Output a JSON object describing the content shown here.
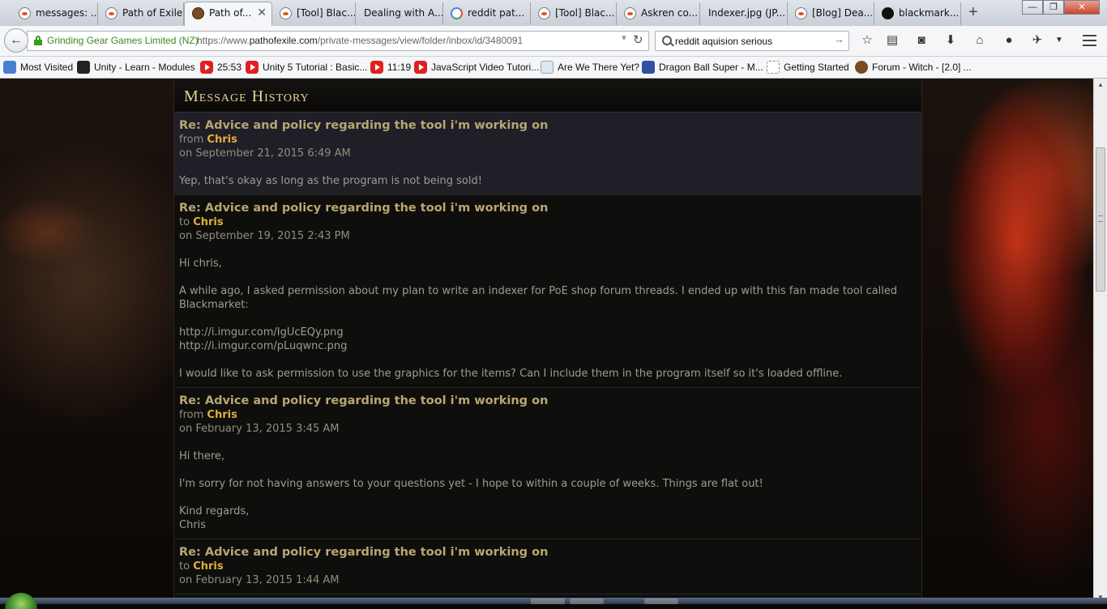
{
  "browser": {
    "tabs": [
      {
        "title": "messages: ...",
        "icon": "reddit-icon",
        "active": false
      },
      {
        "title": "Path of Exile",
        "icon": "reddit-icon",
        "active": false
      },
      {
        "title": "Path of...",
        "icon": "poe-icon",
        "active": true
      },
      {
        "title": "[Tool] Blac...",
        "icon": "reddit-icon",
        "active": false
      },
      {
        "title": "Dealing with A...",
        "icon": "",
        "active": false
      },
      {
        "title": "reddit pat...",
        "icon": "google-icon",
        "active": false
      },
      {
        "title": "[Tool] Blac...",
        "icon": "reddit-icon",
        "active": false
      },
      {
        "title": "Askren co...",
        "icon": "reddit-icon",
        "active": false
      },
      {
        "title": "Indexer.jpg (JP...",
        "icon": "",
        "active": false
      },
      {
        "title": "[Blog] Dea...",
        "icon": "reddit-icon",
        "active": false
      },
      {
        "title": "blackmark...",
        "icon": "github-icon",
        "active": false
      }
    ],
    "new_tab": "+",
    "window_controls": {
      "minimize": "—",
      "maximize": "❐",
      "close": "✕"
    },
    "identity": "Grinding Gear Games Limited (NZ)",
    "url_prefix": "https://www.",
    "url_domain": "pathofexile.com",
    "url_path": "/private-messages/view/folder/inbox/id/3480091",
    "search_value": "reddit aquision serious",
    "bookmarks": [
      {
        "label": "Most Visited",
        "icon": "firefox-icon"
      },
      {
        "label": "Unity - Learn - Modules",
        "icon": "unity-icon"
      },
      {
        "label": "25:53",
        "icon": "youtube-icon"
      },
      {
        "label": "Unity 5 Tutorial : Basic...",
        "icon": "youtube-icon"
      },
      {
        "label": "11:19",
        "icon": "youtube-icon"
      },
      {
        "label": "JavaScript Video Tutori...",
        "icon": "youtube-icon"
      },
      {
        "label": "Are We There Yet?",
        "icon": "info-icon"
      },
      {
        "label": "Dragon Ball Super - M...",
        "icon": "mal-icon"
      },
      {
        "label": "Getting Started",
        "icon": "blank-page-icon"
      },
      {
        "label": "Forum - Witch - [2.0] ...",
        "icon": "forum-icon"
      }
    ]
  },
  "page": {
    "heading": "Message History",
    "messages": [
      {
        "subject": "Re: Advice and policy regarding the tool i'm working on",
        "direction": "from",
        "who": "Chris",
        "date": "on September 21, 2015 6:49 AM",
        "body": [
          "Yep, that's okay as long as the program is not being sold!"
        ]
      },
      {
        "subject": "Re: Advice and policy regarding the tool i'm working on",
        "direction": "to",
        "who": "Chris",
        "date": "on September 19, 2015 2:43 PM",
        "body": [
          "Hi chris,",
          "A while ago, I asked permission about my plan to write an indexer for PoE shop forum threads. I ended up with this fan made tool called Blackmarket:",
          "http://i.imgur.com/IgUcEQy.png",
          "http://i.imgur.com/pLuqwnc.png",
          "I would like to ask permission to use the graphics for the items? Can I include them in the program itself so it's loaded offline."
        ]
      },
      {
        "subject": "Re: Advice and policy regarding the tool i'm working on",
        "direction": "from",
        "who": "Chris",
        "date": "on February 13, 2015 3:45 AM",
        "body": [
          "Hi there,",
          "I'm sorry for not having answers to your questions yet - I hope to within a couple of weeks. Things are flat out!",
          "Kind regards,",
          "Chris"
        ]
      },
      {
        "subject": "Re: Advice and policy regarding the tool i'm working on",
        "direction": "to",
        "who": "Chris",
        "date": "on February 13, 2015 1:44 AM",
        "body": []
      }
    ]
  }
}
